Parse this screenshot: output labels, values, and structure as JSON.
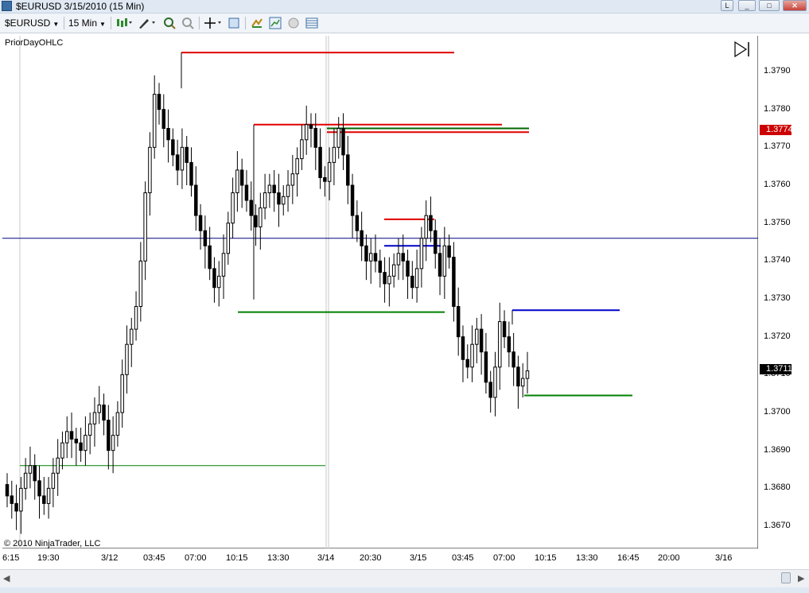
{
  "window": {
    "title": "$EURUSD  3/15/2010 (15 Min)",
    "buttons": [
      "L",
      "_",
      "□",
      "✕"
    ]
  },
  "toolbar": {
    "instrument": "$EURUSD",
    "interval": "15 Min",
    "icons": [
      "bar-type-icon",
      "drawing-tool-icon",
      "zoom-in-icon",
      "zoom-out-icon",
      "crosshair-icon",
      "properties-icon",
      "strategies-icon",
      "indicators-icon",
      "data-box-icon",
      "chart-trader-icon"
    ]
  },
  "chart": {
    "indicator_label": "PriorDayOHLC",
    "copyright": "© 2010 NinjaTrader, LLC",
    "current_price": "1.3711",
    "prior_close_tag": "1.3774",
    "colors": {
      "up": "#ffffff",
      "down": "#000000",
      "high": "#e00000",
      "low": "#008000",
      "open": "#0000cc",
      "hline": "#000080"
    }
  },
  "chart_data": {
    "type": "candlestick",
    "title": "",
    "y_labels": [
      "1.3790",
      "1.3780",
      "1.3770",
      "1.3760",
      "1.3750",
      "1.3740",
      "1.3730",
      "1.3720",
      "1.3710",
      "1.3700",
      "1.3690",
      "1.3680",
      "1.3670"
    ],
    "ylim": [
      1.3665,
      1.3799
    ],
    "x_labels": [
      "6:15",
      "19:30",
      "3/12",
      "03:45",
      "07:00",
      "10:15",
      "13:30",
      "3/14",
      "20:30",
      "3/15",
      "03:45",
      "07:00",
      "10:15",
      "13:30",
      "16:45",
      "20:00",
      "3/16"
    ],
    "horizontal_line": 1.3746,
    "prior_day_levels": [
      {
        "kind": "high",
        "value": 1.3795,
        "from": "3/12 05:30",
        "to": "3/12 20:00"
      },
      {
        "kind": "low",
        "value": 1.3686,
        "from": "3/11 18:30",
        "to": "3/14 17:00"
      },
      {
        "kind": "high",
        "value": 1.3776,
        "from": "3/12 10:00",
        "to": "3/15 10:00"
      },
      {
        "kind": "low",
        "value": 1.37265,
        "from": "3/12 10:00",
        "to": "3/15 10:00"
      },
      {
        "kind": "close",
        "value": 1.3775,
        "from": "3/14 17:00",
        "to": "3/15 11:00"
      },
      {
        "kind": "close",
        "value": 1.3774,
        "from": "3/14 17:00",
        "to": "3/15 11:00"
      },
      {
        "kind": "high",
        "value": 1.3751,
        "from": "3/14 23:00",
        "to": "3/15 02:00"
      },
      {
        "kind": "open",
        "value": 1.3744,
        "from": "3/14 23:00",
        "to": "3/15 02:00"
      },
      {
        "kind": "open",
        "value": 1.3727,
        "from": "3/15 07:00",
        "to": "3/15 15:00"
      },
      {
        "kind": "low",
        "value": 1.37045,
        "from": "3/15 07:00",
        "to": "3/15 15:00"
      }
    ],
    "candles_close": [
      1.3678,
      1.3676,
      1.3674,
      1.368,
      1.3684,
      1.3686,
      1.3682,
      1.3678,
      1.3676,
      1.368,
      1.3684,
      1.3688,
      1.3692,
      1.3695,
      1.3693,
      1.3692,
      1.369,
      1.3694,
      1.3697,
      1.37,
      1.3702,
      1.3698,
      1.369,
      1.3694,
      1.37,
      1.371,
      1.3718,
      1.3722,
      1.3728,
      1.374,
      1.3758,
      1.377,
      1.3784,
      1.378,
      1.3775,
      1.3772,
      1.3768,
      1.3764,
      1.377,
      1.3766,
      1.376,
      1.3752,
      1.3748,
      1.3744,
      1.3738,
      1.3733,
      1.3736,
      1.3742,
      1.375,
      1.3758,
      1.3764,
      1.376,
      1.3756,
      1.3752,
      1.3749,
      1.3754,
      1.3758,
      1.376,
      1.3758,
      1.3755,
      1.3757,
      1.376,
      1.3763,
      1.3767,
      1.3772,
      1.3776,
      1.3775,
      1.377,
      1.3762,
      1.3761,
      1.3766,
      1.377,
      1.3775,
      1.3768,
      1.376,
      1.3752,
      1.3748,
      1.3744,
      1.374,
      1.3742,
      1.374,
      1.3737,
      1.3734,
      1.3736,
      1.3739,
      1.3742,
      1.374,
      1.3736,
      1.3733,
      1.3738,
      1.3746,
      1.3752,
      1.3748,
      1.3742,
      1.3736,
      1.3744,
      1.3741,
      1.3728,
      1.372,
      1.3714,
      1.3712,
      1.3718,
      1.3722,
      1.3716,
      1.3708,
      1.3704,
      1.3712,
      1.3724,
      1.372,
      1.3716,
      1.3712,
      1.3707,
      1.3709,
      1.3711
    ]
  }
}
